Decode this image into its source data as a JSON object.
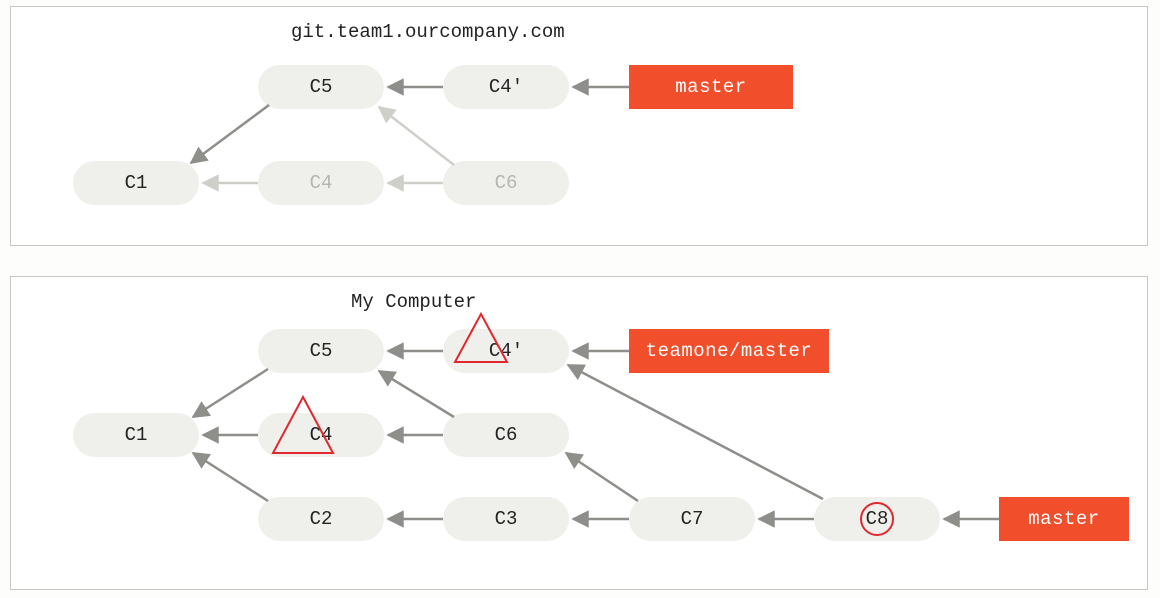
{
  "colors": {
    "node_bg": "#efefec",
    "branch_bg": "#f14e2b",
    "branch_fg": "#ffffff",
    "panel_border": "#c7c7c3",
    "faded_text": "#b6b6b0",
    "arrow": "#8e8e8a",
    "arrow_faded": "#cfcfca",
    "annotation": "#e0282e"
  },
  "panels": {
    "remote": {
      "title": "git.team1.ourcompany.com",
      "nodes": {
        "c1": "C1",
        "c5": "C5",
        "c4p": "C4'",
        "c4": "C4",
        "c6": "C6"
      },
      "branches": {
        "master": "master"
      },
      "faded_nodes": [
        "c4",
        "c6"
      ],
      "edges": [
        {
          "from": "c5",
          "to": "c1",
          "faded": false
        },
        {
          "from": "c4p",
          "to": "c5",
          "faded": false
        },
        {
          "from": "master",
          "to": "c4p",
          "faded": false
        },
        {
          "from": "c4",
          "to": "c1",
          "faded": true
        },
        {
          "from": "c6",
          "to": "c4",
          "faded": true
        },
        {
          "from": "c6",
          "to": "c5",
          "faded": true
        }
      ]
    },
    "local": {
      "title": "My Computer",
      "nodes": {
        "c1": "C1",
        "c5": "C5",
        "c4p": "C4'",
        "c4": "C4",
        "c6": "C6",
        "c2": "C2",
        "c3": "C3",
        "c7": "C7",
        "c8": "C8"
      },
      "branches": {
        "teamone_master": "teamone/master",
        "master": "master"
      },
      "edges": [
        {
          "from": "c5",
          "to": "c1"
        },
        {
          "from": "c4p",
          "to": "c5"
        },
        {
          "from": "teamone_master",
          "to": "c4p"
        },
        {
          "from": "c4",
          "to": "c1"
        },
        {
          "from": "c6",
          "to": "c4"
        },
        {
          "from": "c6",
          "to": "c5"
        },
        {
          "from": "c2",
          "to": "c1"
        },
        {
          "from": "c3",
          "to": "c2"
        },
        {
          "from": "c7",
          "to": "c3"
        },
        {
          "from": "c7",
          "to": "c6"
        },
        {
          "from": "c8",
          "to": "c7"
        },
        {
          "from": "c8",
          "to": "c4p"
        },
        {
          "from": "master",
          "to": "c8"
        }
      ],
      "annotations": [
        {
          "shape": "triangle",
          "on": "c4"
        },
        {
          "shape": "triangle",
          "on": "c4p"
        },
        {
          "shape": "circle",
          "on": "c8"
        }
      ]
    }
  }
}
